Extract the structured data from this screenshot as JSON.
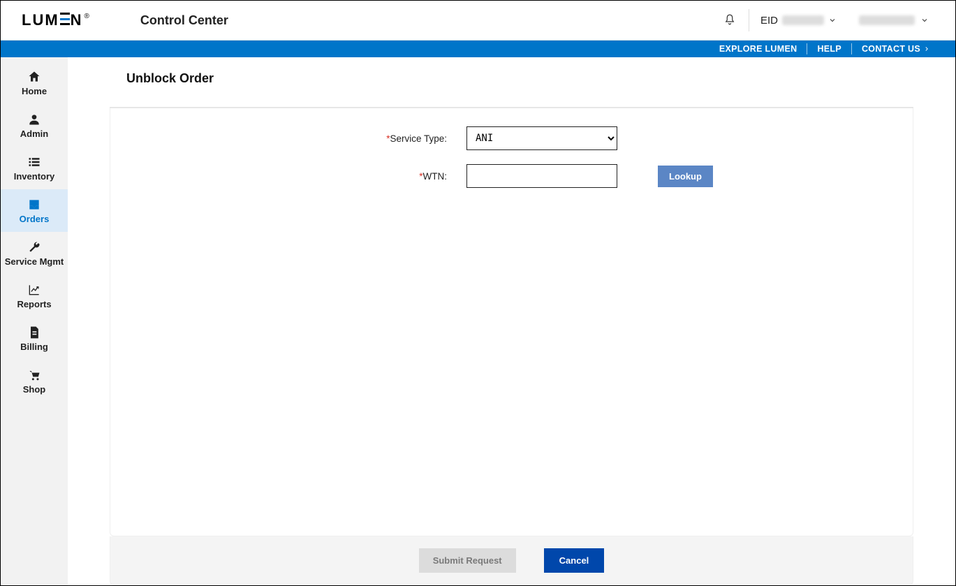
{
  "header": {
    "logo_text_left": "LUM",
    "logo_text_right": "N",
    "app_title": "Control Center",
    "eid_label": "EID"
  },
  "bluebar": {
    "explore": "EXPLORE LUMEN",
    "help": "HELP",
    "contact": "CONTACT US"
  },
  "sidebar": {
    "items": [
      {
        "label": "Home"
      },
      {
        "label": "Admin"
      },
      {
        "label": "Inventory"
      },
      {
        "label": "Orders"
      },
      {
        "label": "Service Mgmt"
      },
      {
        "label": "Reports"
      },
      {
        "label": "Billing"
      },
      {
        "label": "Shop"
      }
    ]
  },
  "page": {
    "title": "Unblock Order",
    "service_type_label": "Service Type:",
    "service_type_value": "ANI",
    "wtn_label": "WTN:",
    "wtn_value": "",
    "lookup_label": "Lookup"
  },
  "footer": {
    "submit": "Submit Request",
    "cancel": "Cancel"
  }
}
